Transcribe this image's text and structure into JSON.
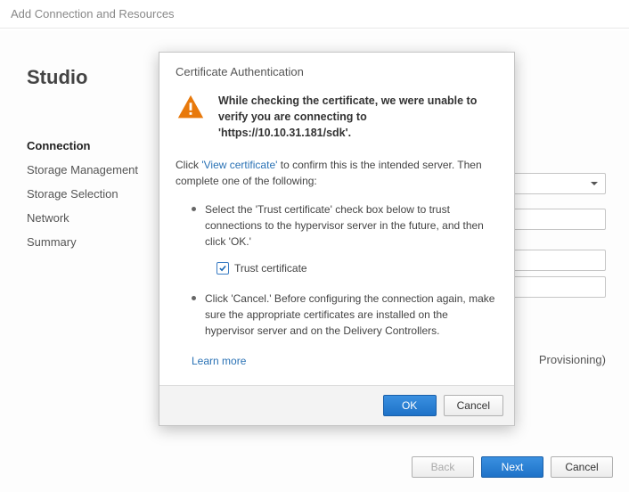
{
  "window": {
    "title": "Add Connection and Resources"
  },
  "sidebar": {
    "title": "Studio",
    "steps": [
      {
        "label": "Connection",
        "active": true
      },
      {
        "label": "Storage Management",
        "active": false
      },
      {
        "label": "Storage Selection",
        "active": false
      },
      {
        "label": "Network",
        "active": false
      },
      {
        "label": "Summary",
        "active": false
      }
    ]
  },
  "background": {
    "provisioning_note": "Provisioning)"
  },
  "wizard_buttons": {
    "back": "Back",
    "next": "Next",
    "cancel": "Cancel"
  },
  "modal": {
    "title": "Certificate Authentication",
    "alert": "While checking the certificate, we were unable to verify you are connecting to 'https://10.10.31.181/sdk'.",
    "intro_pre": "Click ",
    "intro_link": "'View certificate'",
    "intro_post": " to confirm this is the intended server. Then complete one of the following:",
    "bullet1": "Select the 'Trust certificate' check box below to trust connections to the hypervisor server in the future, and then click 'OK.'",
    "trust_checkbox_label": "Trust certificate",
    "trust_checkbox_checked": true,
    "bullet2": "Click 'Cancel.' Before configuring the connection again, make sure the appropriate certificates are installed on the hypervisor server and on the Delivery Controllers.",
    "learn_more": "Learn more",
    "ok": "OK",
    "cancel": "Cancel"
  }
}
